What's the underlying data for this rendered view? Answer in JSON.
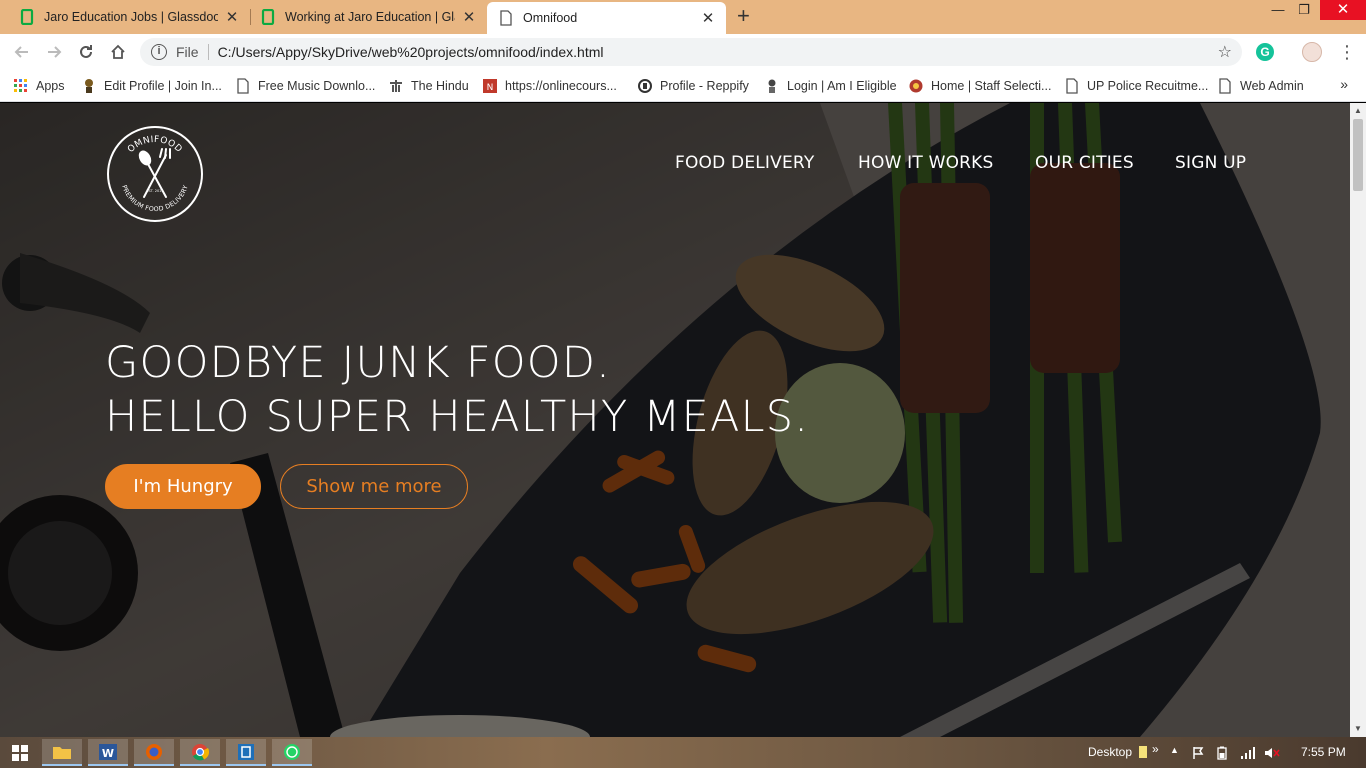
{
  "browser": {
    "tabs": [
      {
        "title": "Jaro Education Jobs | Glassdoor.c",
        "active": false
      },
      {
        "title": "Working at Jaro Education | Glass",
        "active": false
      },
      {
        "title": "Omnifood",
        "active": true
      }
    ],
    "new_tab": "+",
    "window_controls": {
      "minimize": "—",
      "restore": "❐",
      "close": "✕"
    },
    "address": {
      "scheme": "File",
      "url": "C:/Users/Appy/SkyDrive/web%20projects/omnifood/index.html"
    },
    "bookmarks": [
      {
        "label": "Apps"
      },
      {
        "label": "Edit Profile | Join In..."
      },
      {
        "label": "Free Music Downlo..."
      },
      {
        "label": "The Hindu"
      },
      {
        "label": "https://onlinecours..."
      },
      {
        "label": "Profile - Reppify"
      },
      {
        "label": "Login | Am I Eligible"
      },
      {
        "label": "Home | Staff Selecti..."
      },
      {
        "label": "UP Police Recuitme..."
      },
      {
        "label": "Web Admin"
      }
    ],
    "bookmarks_more": "»",
    "accent": "#e8b682"
  },
  "site": {
    "logo": {
      "top_text": "OMNIFOOD",
      "bottom_text": "PREMIUM FOOD DELIVERY",
      "est": "EST. 2015"
    },
    "nav": [
      "FOOD DELIVERY",
      "HOW IT WORKS",
      "OUR CITIES",
      "SIGN UP"
    ],
    "headline_line1": "GOODBYE JUNK FOOD.",
    "headline_line2": "HELLO SUPER HEALTHY MEALS.",
    "btn_primary": "I'm Hungry",
    "btn_secondary": "Show me more",
    "brand_color": "#e67e22"
  },
  "taskbar": {
    "desktop_label": "Desktop",
    "chevron": "»",
    "time": "7:55 PM"
  }
}
